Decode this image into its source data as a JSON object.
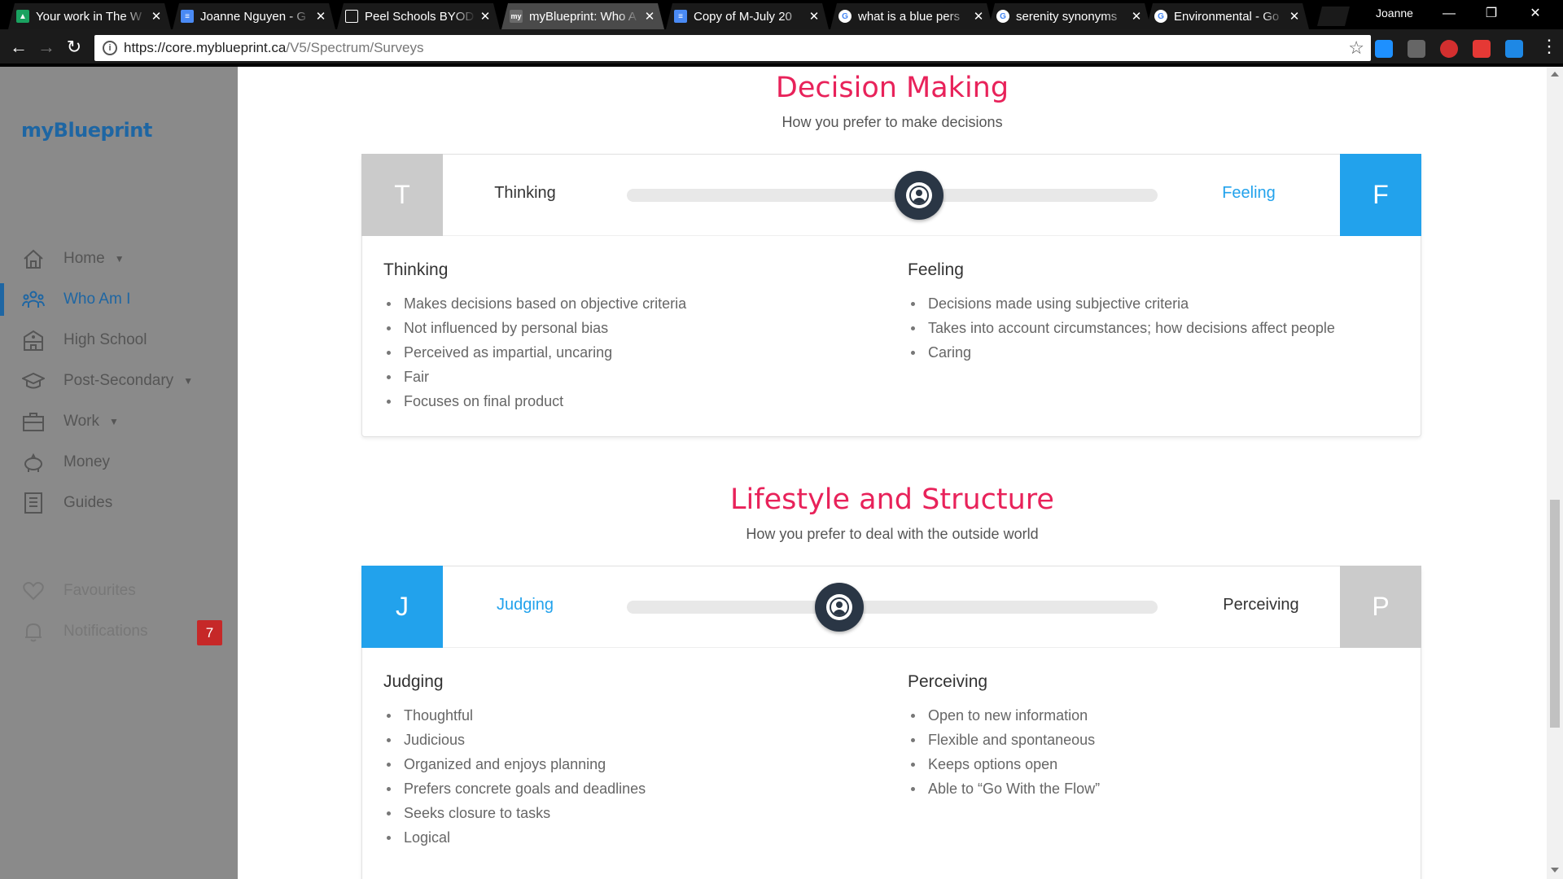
{
  "browser": {
    "tabs": [
      {
        "title": "Your work in The W",
        "favicon_color": "#1aa260",
        "active": false
      },
      {
        "title": "Joanne Nguyen - G",
        "favicon_color": "#4a8af4",
        "active": false
      },
      {
        "title": "Peel Schools BYOD",
        "favicon_color": "#ffffff",
        "active": false
      },
      {
        "title": "myBlueprint: Who A",
        "favicon_color": "#6b6b6b",
        "active": true
      },
      {
        "title": "Copy of M-July 20",
        "favicon_color": "#4a8af4",
        "active": false
      },
      {
        "title": "what is a blue pers",
        "favicon_color": "#ffffff",
        "active": false
      },
      {
        "title": "serenity synonyms",
        "favicon_color": "#ffffff",
        "active": false
      },
      {
        "title": "Environmental - Go",
        "favicon_color": "#ffffff",
        "active": false
      }
    ],
    "profile_name": "Joanne",
    "url_host": "https://core.myblueprint.ca",
    "url_path": "/V5/Spectrum/Surveys"
  },
  "sidebar": {
    "brand": "myBlueprint",
    "items": [
      {
        "label": "Home",
        "icon": "home-icon",
        "caret": true,
        "active": false
      },
      {
        "label": "Who Am I",
        "icon": "people-icon",
        "caret": false,
        "active": true
      },
      {
        "label": "High School",
        "icon": "school-icon",
        "caret": false,
        "active": false
      },
      {
        "label": "Post-Secondary",
        "icon": "graduation-cap-icon",
        "caret": true,
        "active": false
      },
      {
        "label": "Work",
        "icon": "briefcase-icon",
        "caret": true,
        "active": false
      },
      {
        "label": "Money",
        "icon": "piggy-bank-icon",
        "caret": false,
        "active": false
      },
      {
        "label": "Guides",
        "icon": "guide-icon",
        "caret": false,
        "active": false
      }
    ],
    "favourites": "Favourites",
    "notifications": "Notifications",
    "notifications_count": "7"
  },
  "sections": [
    {
      "title": "Decision Making",
      "subtitle": "How you prefer to make decisions",
      "left_letter": "T",
      "right_letter": "F",
      "left_pole": "Thinking",
      "right_pole": "Feeling",
      "preferred": "right",
      "slider_position": 0.55,
      "left_heading": "Thinking",
      "left_items": [
        "Makes decisions based on objective criteria",
        "Not influenced by personal bias",
        "Perceived as impartial, uncaring",
        "Fair",
        "Focuses on final product"
      ],
      "right_heading": "Feeling",
      "right_items": [
        "Decisions made using subjective criteria",
        "Takes into account circumstances; how decisions affect people",
        "Caring"
      ]
    },
    {
      "title": "Lifestyle and Structure",
      "subtitle": "How you prefer to deal with the outside world",
      "left_letter": "J",
      "right_letter": "P",
      "left_pole": "Judging",
      "right_pole": "Perceiving",
      "preferred": "left",
      "slider_position": 0.4,
      "left_heading": "Judging",
      "left_items": [
        "Thoughtful",
        "Judicious",
        "Organized and enjoys planning",
        "Prefers concrete goals and deadlines",
        "Seeks closure to tasks",
        "Logical"
      ],
      "right_heading": "Perceiving",
      "right_items": [
        "Open to new information",
        "Flexible and spontaneous",
        "Keeps options open",
        "Able to “Go With the Flow”"
      ]
    }
  ],
  "colors": {
    "accent": "#e8225a",
    "brand": "#1e66a3",
    "preferred": "#22a2ec",
    "unpreferred": "#cbcbcb",
    "badge": "#c62828"
  }
}
